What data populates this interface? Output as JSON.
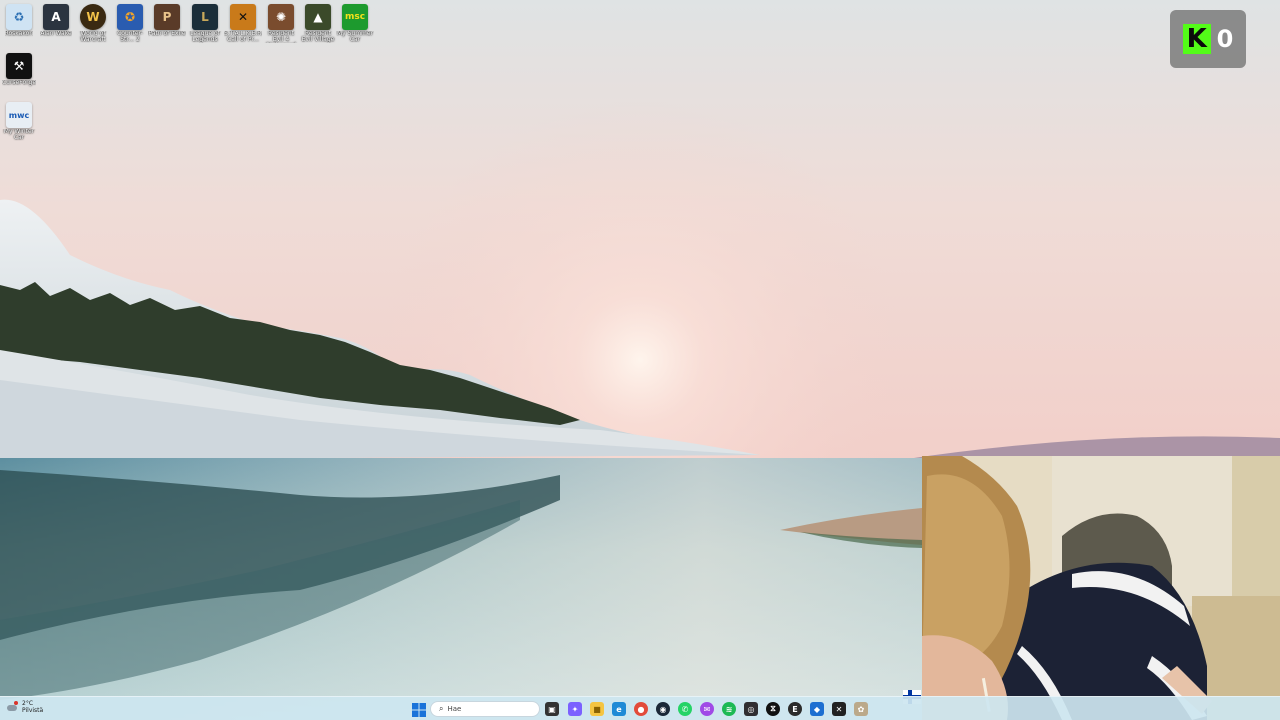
{
  "desktop": {
    "icons": [
      {
        "label": "Roskakori",
        "icon": "recycle-bin-icon",
        "color": "#cfe3f3"
      },
      {
        "label": "Alan Wake",
        "icon": "alan-wake-icon",
        "color": "#2b3440"
      },
      {
        "label": "World of Warcraft",
        "icon": "warcraft-icon",
        "color": "#3a2a12"
      },
      {
        "label": "Counter-Str... 2",
        "icon": "counter-strike-icon",
        "color": "#2a5cb0"
      },
      {
        "label": "Path of Exile",
        "icon": "path-of-exile-icon",
        "color": "#5a3b28"
      },
      {
        "label": "League of Legends",
        "icon": "league-of-legends-icon",
        "color": "#1b2e3a"
      },
      {
        "label": "S.T.A.L.K.E.R. Call of Pr...",
        "icon": "stalker-icon",
        "color": "#c97a1a"
      },
      {
        "label": "Resident Evil 4 Biohazard",
        "icon": "resident-evil-icon",
        "color": "#7a4c2e"
      },
      {
        "label": "Resident Evil Village",
        "icon": "re-village-icon",
        "color": "#3b4a2a"
      },
      {
        "label": "My Summer Car",
        "icon": "my-summer-car-icon",
        "color": "#1d9a2e"
      },
      {
        "label": "CurseForge",
        "icon": "curseforge-icon",
        "color": "#111111"
      },
      {
        "label": "My Winter Car",
        "icon": "my-winter-car-icon",
        "color": "#e8eef4"
      }
    ]
  },
  "overlay": {
    "kick_logo": "K",
    "kick_count": "0",
    "kick_color": "#53fc18"
  },
  "taskbar": {
    "weather_temp": "2°C",
    "weather_desc": "Pilvistä",
    "search_placeholder": "Hae",
    "apps": [
      {
        "name": "task-view-icon",
        "color": "#333333",
        "glyph": "▣"
      },
      {
        "name": "copilot-icon",
        "color": "#7b61ff",
        "glyph": "✦"
      },
      {
        "name": "file-explorer-icon",
        "color": "#f5c542",
        "glyph": "■"
      },
      {
        "name": "edge-icon",
        "color": "#1f8ad6",
        "glyph": "e"
      },
      {
        "name": "chrome-icon",
        "color": "#e24b3b",
        "glyph": "●"
      },
      {
        "name": "steam-icon",
        "color": "#1b2838",
        "glyph": "◉"
      },
      {
        "name": "whatsapp-icon",
        "color": "#25d366",
        "glyph": "✆"
      },
      {
        "name": "messenger-icon",
        "color": "#a04ae6",
        "glyph": "✉"
      },
      {
        "name": "spotify-icon",
        "color": "#1db954",
        "glyph": "≋"
      },
      {
        "name": "obs-icon",
        "color": "#302e31",
        "glyph": "◎"
      },
      {
        "name": "capcut-icon",
        "color": "#111111",
        "glyph": "⧖"
      },
      {
        "name": "epic-games-icon",
        "color": "#2b2b2b",
        "glyph": "E"
      },
      {
        "name": "app-blue-icon",
        "color": "#1d6fd1",
        "glyph": "◆"
      },
      {
        "name": "app-x-icon",
        "color": "#222222",
        "glyph": "✕"
      },
      {
        "name": "app-extra-icon",
        "color": "#bba98a",
        "glyph": "✿"
      }
    ]
  }
}
